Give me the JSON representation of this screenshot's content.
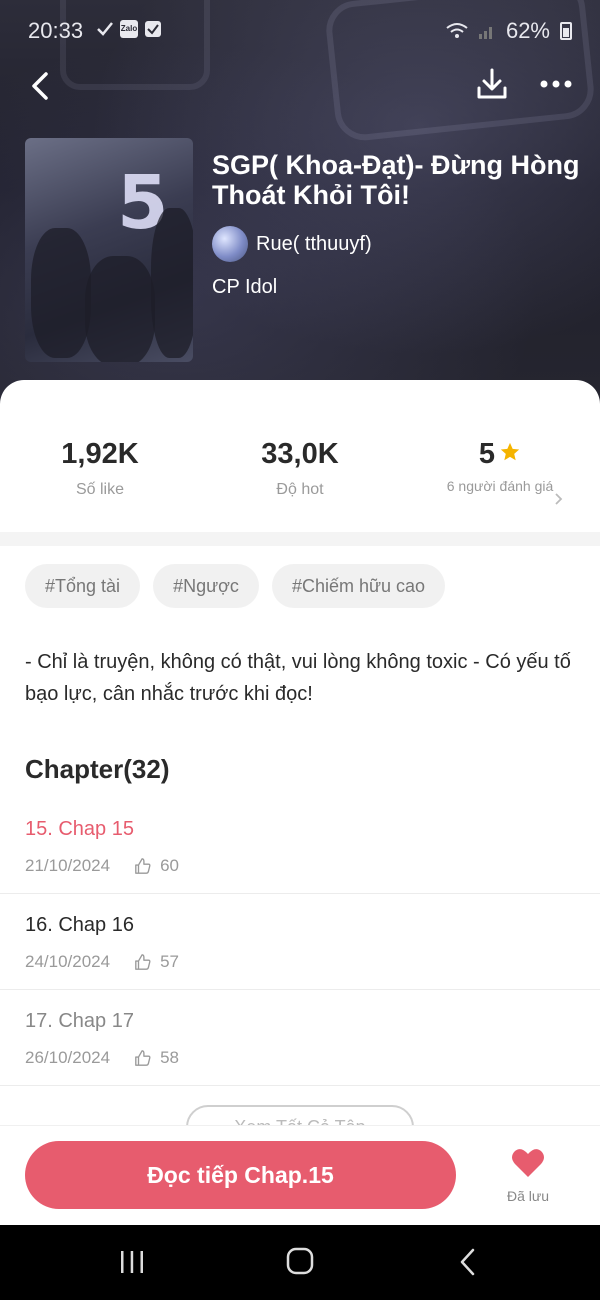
{
  "status_bar": {
    "time": "20:33",
    "battery": "62%",
    "notif_icons": [
      "check-icon",
      "zalo-icon",
      "checkbox-icon"
    ],
    "zalo_label": "Zalo"
  },
  "story": {
    "title": "SGP( Khoa-Đạt)- Đừng Hòng Thoát Khỏi Tôi!",
    "author": "Rue( tthuuyf)",
    "category": "CP Idol",
    "cover_text": "5"
  },
  "stats": [
    {
      "value": "1,92K",
      "label": "Số like"
    },
    {
      "value": "33,0K",
      "label": "Độ hot"
    },
    {
      "value": "5",
      "label": "6 người đánh giá"
    }
  ],
  "tags": [
    "#Tổng tài",
    "#Ngược",
    "#Chiếm hữu cao"
  ],
  "description": "- Chỉ là truyện, không có thật, vui lòng không toxic - Có yếu tố bạo lực, cân nhắc trước khi đọc!",
  "chapters_heading": "Chapter(32)",
  "chapters": [
    {
      "name": "15. Chap 15",
      "date": "21/10/2024",
      "likes": "60",
      "color": "#e75c6e"
    },
    {
      "name": "16. Chap 16",
      "date": "24/10/2024",
      "likes": "57",
      "color": "#2a2a2a"
    },
    {
      "name": "17. Chap 17",
      "date": "26/10/2024",
      "likes": "58",
      "color": "#888888"
    }
  ],
  "more_button": "Xem Tất Cả Tập",
  "read_button": "Đọc tiếp Chap.15",
  "saved_label": "Đã lưu",
  "colors": {
    "accent": "#e75c6e",
    "star": "#f5b400"
  }
}
